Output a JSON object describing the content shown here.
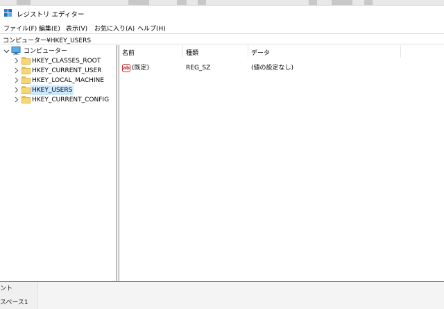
{
  "window": {
    "title": "レジストリ エディター"
  },
  "menu": {
    "items": [
      {
        "label": "ファイル(F)"
      },
      {
        "label": "編集(E)"
      },
      {
        "label": "表示(V)"
      },
      {
        "label": "お気に入り(A)"
      },
      {
        "label": "ヘルプ(H)"
      }
    ]
  },
  "address": {
    "path": "コンピューター¥HKEY_USERS"
  },
  "tree": {
    "root_label": "コンピューター",
    "items": [
      {
        "label": "HKEY_CLASSES_ROOT",
        "selected": false
      },
      {
        "label": "HKEY_CURRENT_USER",
        "selected": false
      },
      {
        "label": "HKEY_LOCAL_MACHINE",
        "selected": false
      },
      {
        "label": "HKEY_USERS",
        "selected": true
      },
      {
        "label": "HKEY_CURRENT_CONFIG",
        "selected": false
      }
    ]
  },
  "list": {
    "columns": [
      "名前",
      "種類",
      "データ"
    ],
    "rows": [
      {
        "icon": "string-value-icon",
        "name": "(既定)",
        "type": "REG_SZ",
        "data": "(値の設定なし)"
      }
    ]
  },
  "background": {
    "sidebar_items": [
      "ント",
      "スペース1"
    ]
  },
  "colors": {
    "selection": "#cce8ff",
    "folder": "#f7d774",
    "accent_blue": "#1e73be"
  }
}
